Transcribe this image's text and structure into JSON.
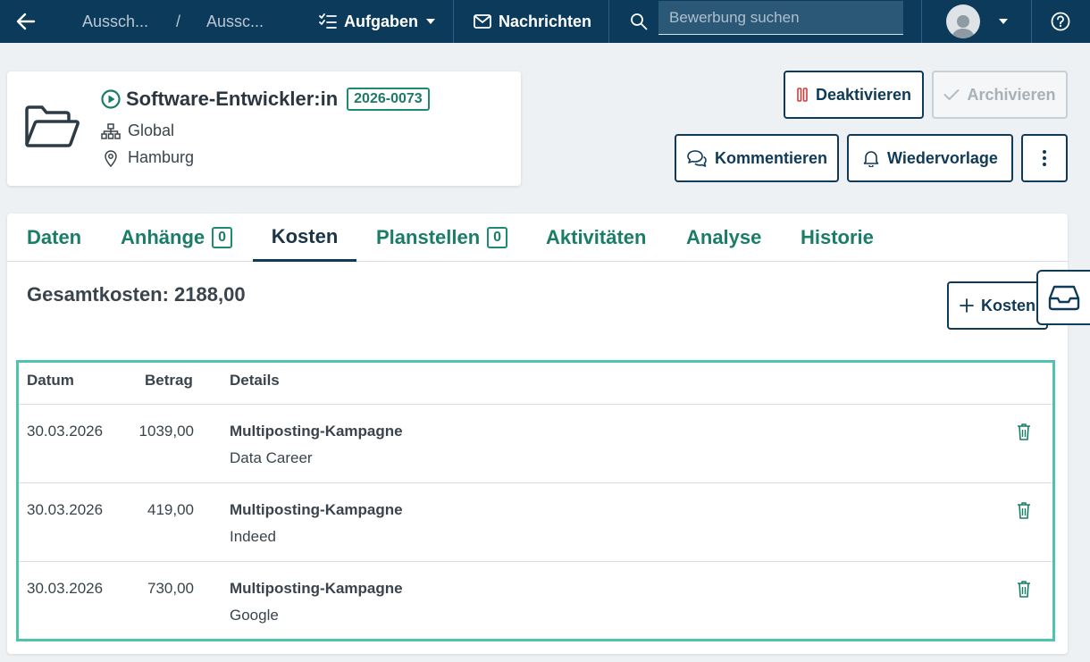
{
  "topbar": {
    "breadcrumb_1": "Aussch...",
    "breadcrumb_sep": "/",
    "breadcrumb_2": "Aussc...",
    "aufgaben_label": "Aufgaben",
    "nachrichten_label": "Nachrichten",
    "search_placeholder": "Bewerbung suchen"
  },
  "job": {
    "title": "Software-Entwickler:in",
    "badge": "2026-0073",
    "org": "Global",
    "location": "Hamburg"
  },
  "actions": {
    "deaktivieren": "Deaktivieren",
    "archivieren": "Archivieren",
    "kommentieren": "Kommentieren",
    "wiedervorlage": "Wiedervorlage"
  },
  "tabs": [
    {
      "label": "Daten"
    },
    {
      "label": "Anhänge",
      "count": "0"
    },
    {
      "label": "Kosten"
    },
    {
      "label": "Planstellen",
      "count": "0"
    },
    {
      "label": "Aktivitäten"
    },
    {
      "label": "Analyse"
    },
    {
      "label": "Historie"
    }
  ],
  "costs": {
    "total_label": "Gesamtkosten: 2188,00",
    "add_label": "Kosten",
    "headers": {
      "date": "Datum",
      "amount": "Betrag",
      "details": "Details"
    },
    "rows": [
      {
        "date": "30.03.2026",
        "amount": "1039,00",
        "title": "Multiposting-Kampagne",
        "sub": "Data Career"
      },
      {
        "date": "30.03.2026",
        "amount": "419,00",
        "title": "Multiposting-Kampagne",
        "sub": "Indeed"
      },
      {
        "date": "30.03.2026",
        "amount": "730,00",
        "title": "Multiposting-Kampagne",
        "sub": "Google"
      }
    ]
  },
  "colors": {
    "nav": "#0b3a5b",
    "accent_green": "#1a7d68",
    "table_highlight": "#4fc3ad",
    "danger": "#d33c3c"
  }
}
